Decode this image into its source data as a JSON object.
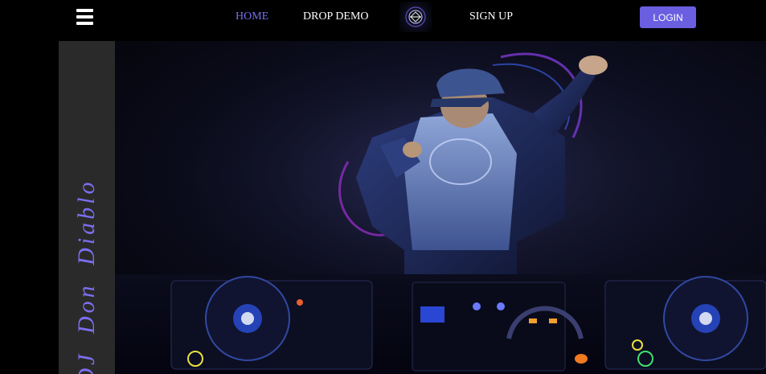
{
  "nav": {
    "home": "HOME",
    "drop_demo": "DROP DEMO",
    "sign_up": "SIGN UP",
    "login": "LOGIN"
  },
  "hero": {
    "side_title": "DJ Don Diablo"
  },
  "colors": {
    "accent": "#7b6ff0",
    "login_button": "#6a5fe0",
    "side_panel": "#2a2a2a",
    "background": "#000000"
  },
  "icons": {
    "menu": "hamburger-menu-icon",
    "logo": "dj-logo-icon"
  }
}
